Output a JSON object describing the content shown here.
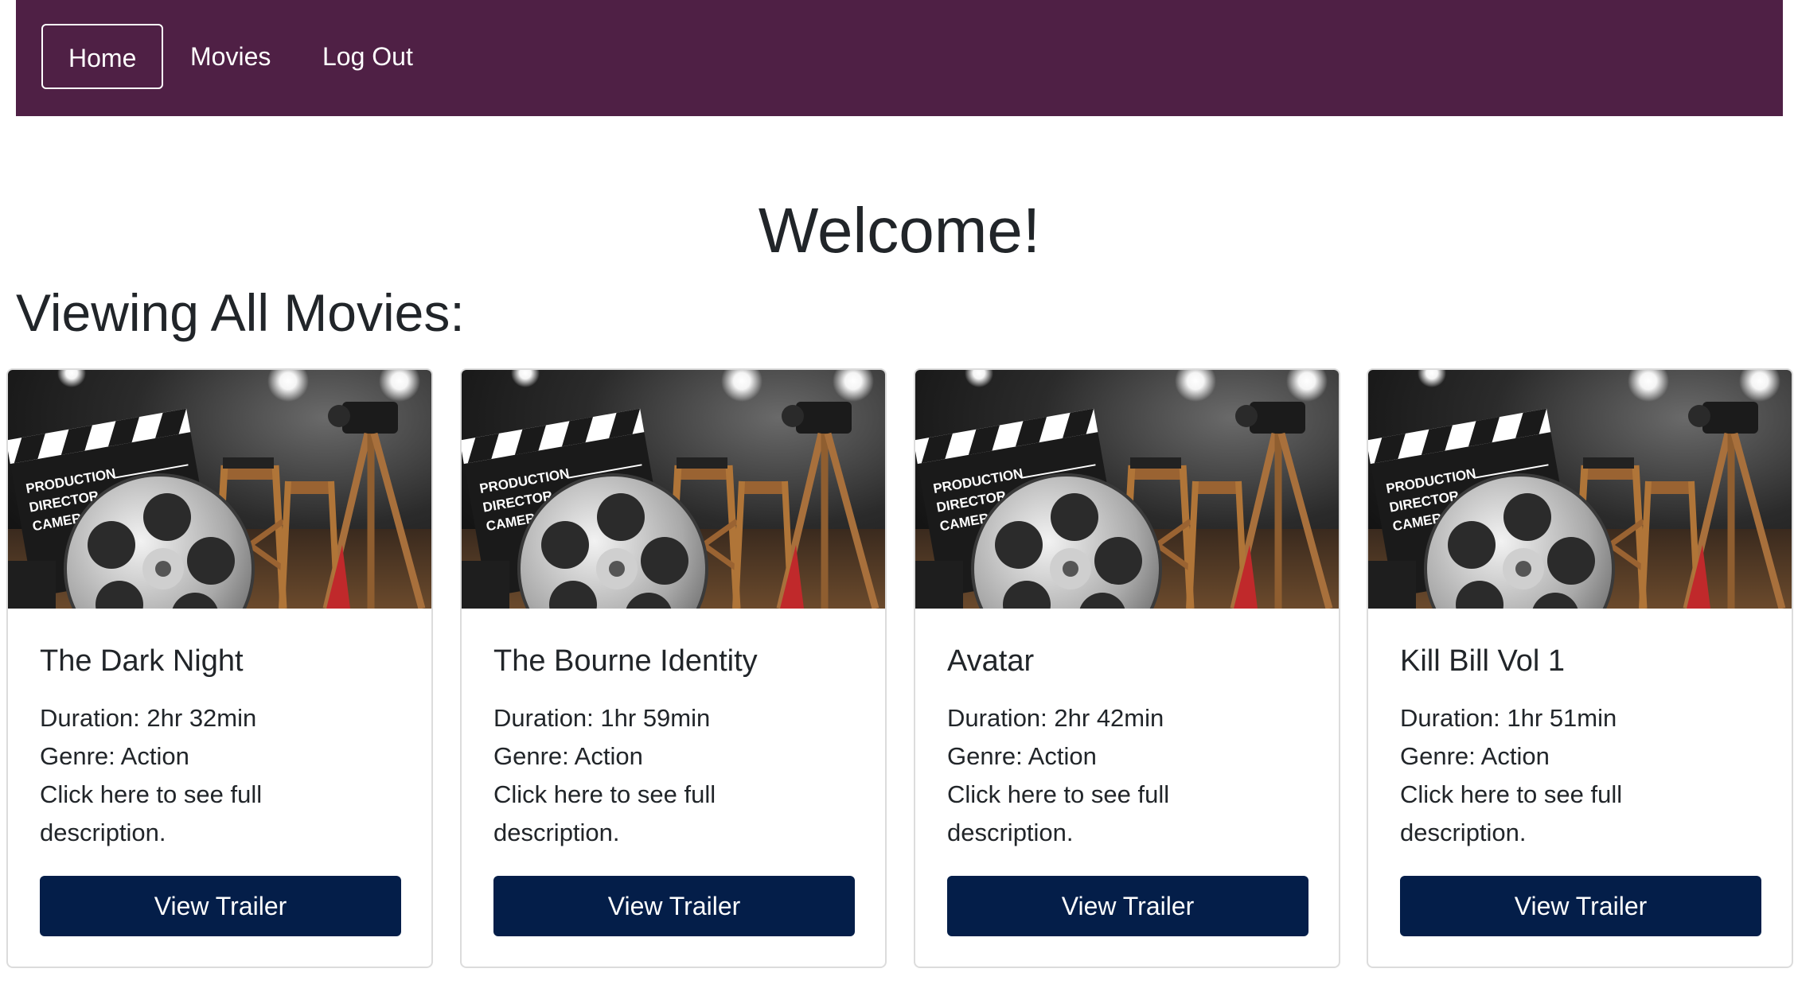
{
  "nav": {
    "items": [
      {
        "label": "Home",
        "active": true
      },
      {
        "label": "Movies",
        "active": false
      },
      {
        "label": "Log Out",
        "active": false
      }
    ],
    "background": "#4f2045"
  },
  "main": {
    "welcome": "Welcome!",
    "section_title": "Viewing All Movies:"
  },
  "movies": [
    {
      "title": "The Dark Night",
      "duration": "Duration: 2hr 32min",
      "genre": "Genre: Action",
      "description_line1": "Click here to see full",
      "description_line2": "description.",
      "button_label": "View Trailer",
      "image_icon": "movie-production-image"
    },
    {
      "title": "The Bourne Identity",
      "duration": "Duration: 1hr 59min",
      "genre": "Genre: Action",
      "description_line1": "Click here to see full",
      "description_line2": "description.",
      "button_label": "View Trailer",
      "image_icon": "movie-production-image"
    },
    {
      "title": "Avatar",
      "duration": "Duration: 2hr 42min",
      "genre": "Genre: Action",
      "description_line1": "Click here to see full",
      "description_line2": "description.",
      "button_label": "View Trailer",
      "image_icon": "movie-production-image"
    },
    {
      "title": "Kill Bill Vol 1",
      "duration": "Duration: 1hr 51min",
      "genre": "Genre: Action",
      "description_line1": "Click here to see full",
      "description_line2": "description.",
      "button_label": "View Trailer",
      "image_icon": "movie-production-image"
    }
  ],
  "colors": {
    "button": "#041e49",
    "text": "#212529"
  }
}
